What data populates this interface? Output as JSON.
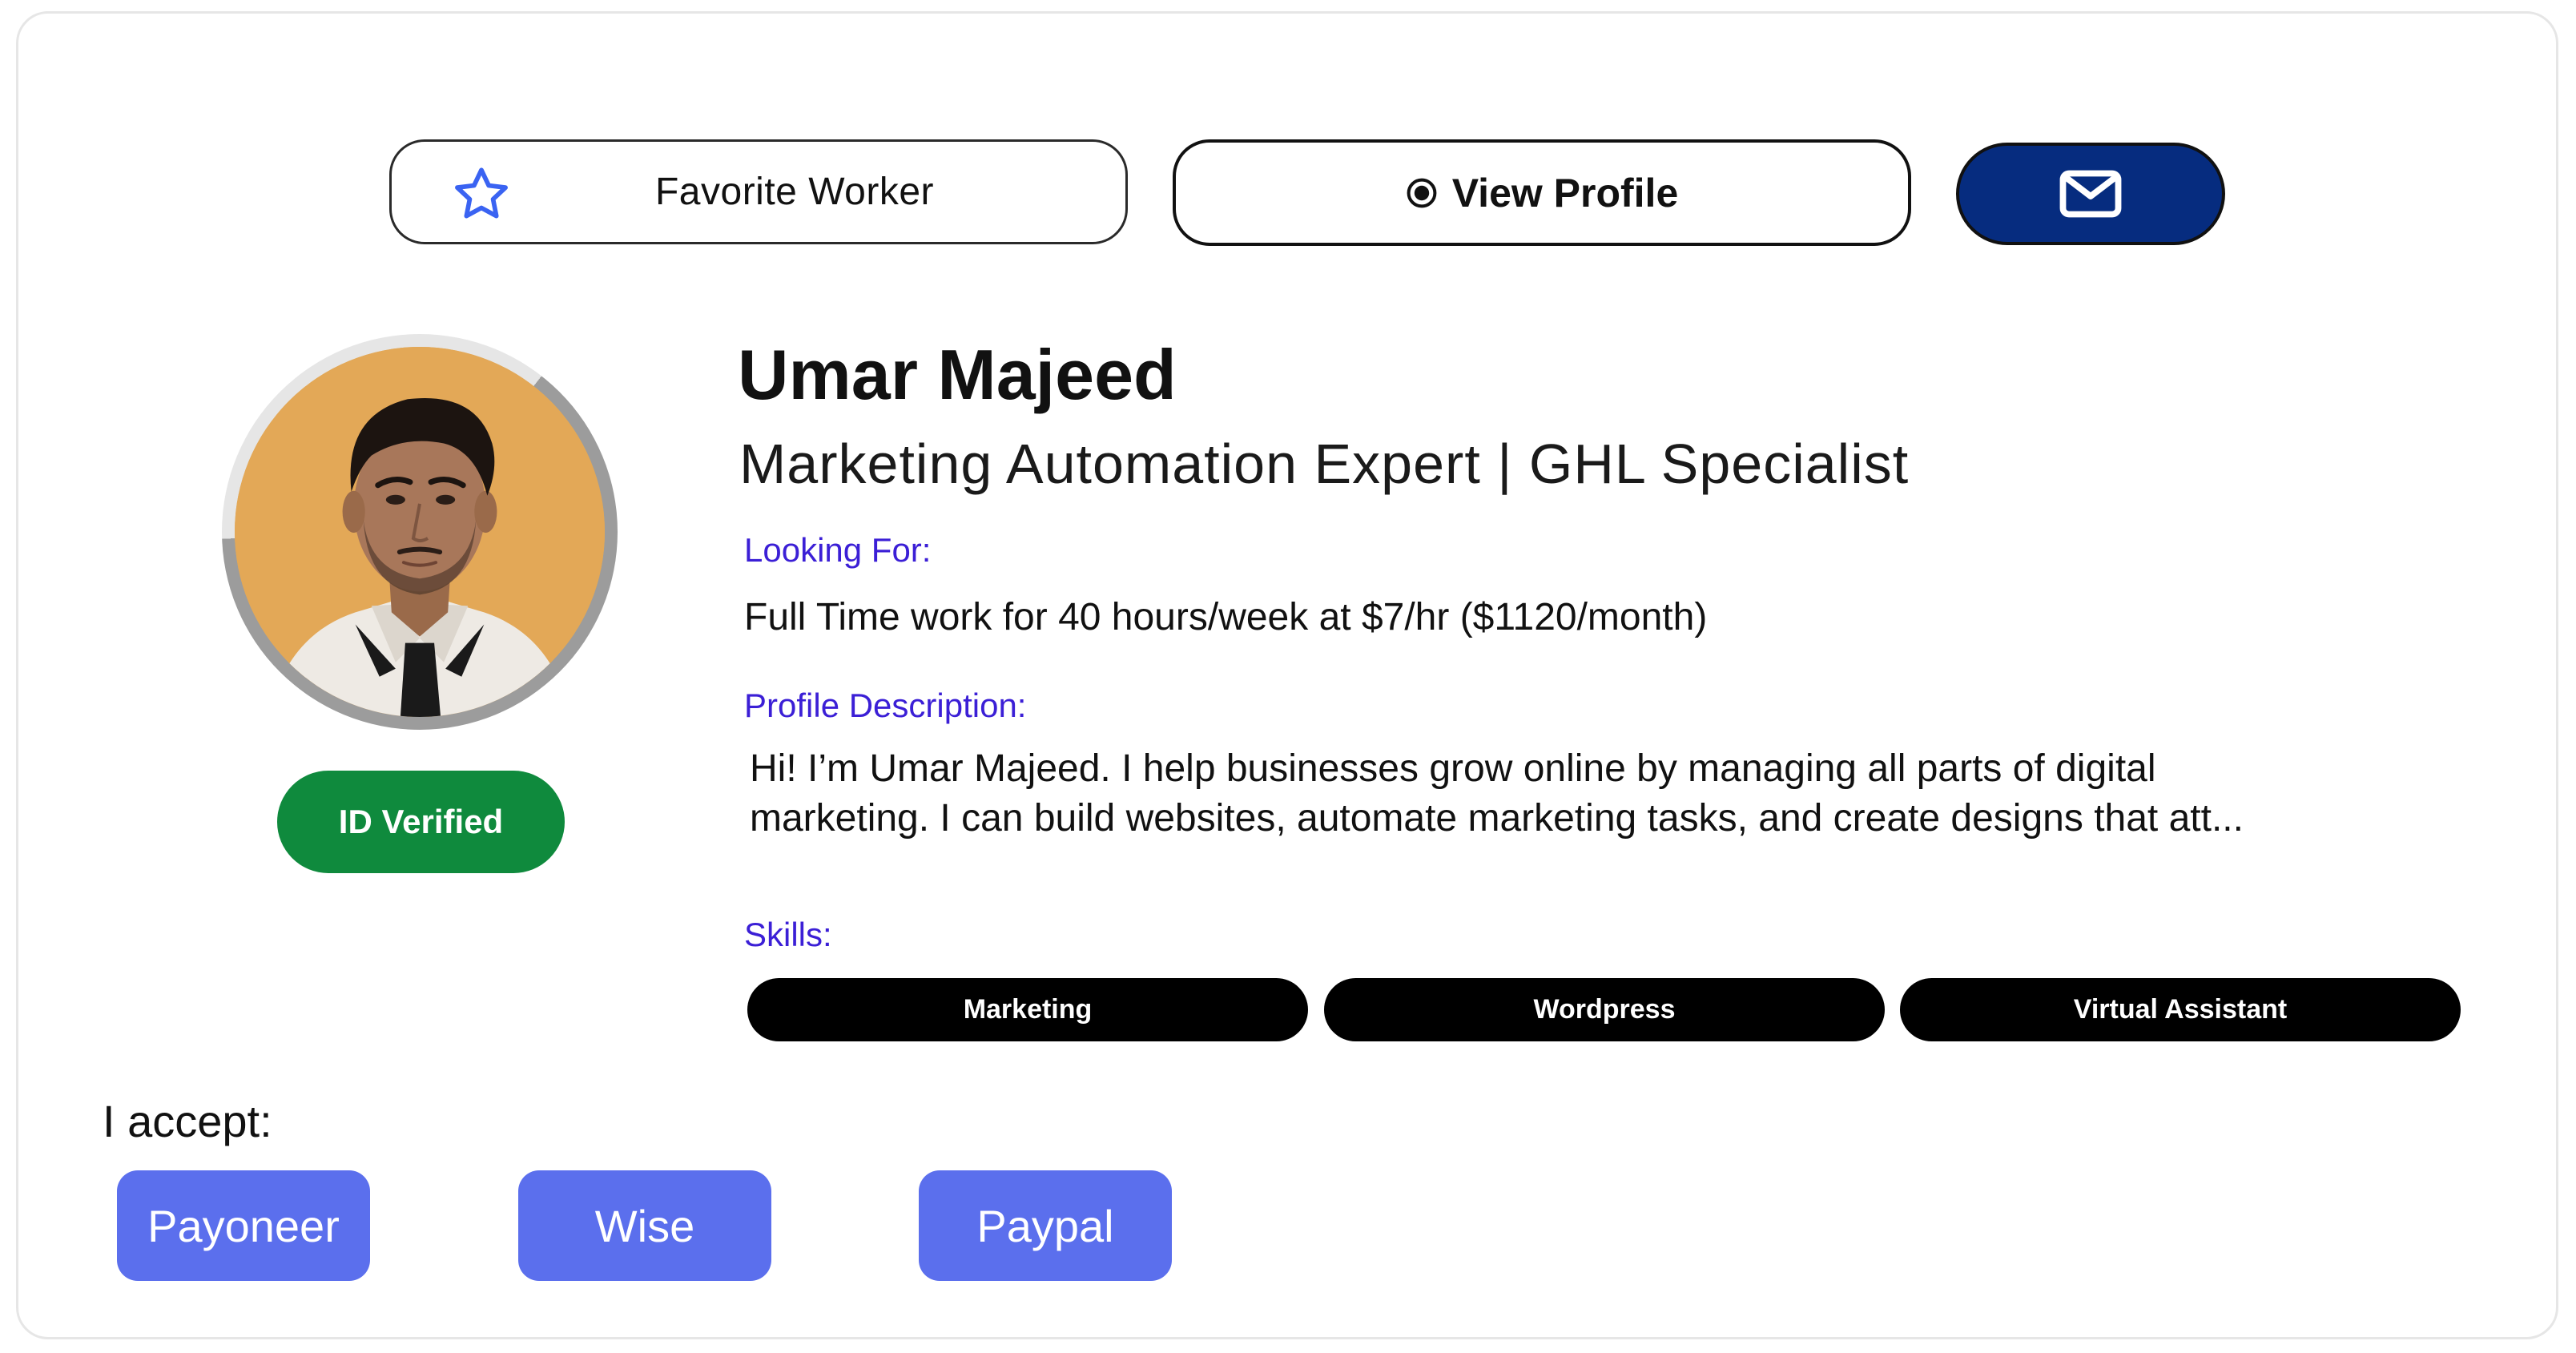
{
  "actions": {
    "favorite_label": "Favorite Worker",
    "view_profile_label": "View Profile",
    "favorite_icon": "star-icon",
    "view_profile_icon": "radio-dot-icon",
    "message_icon": "envelope-icon"
  },
  "profile": {
    "name": "Umar Majeed",
    "headline": "Marketing Automation Expert | GHL Specialist",
    "verified_badge": "ID Verified",
    "looking_for_label": "Looking For:",
    "looking_for_value": "Full Time work for 40 hours/week at $7/hr ($1120/month)",
    "description_label": "Profile Description:",
    "description_value": "Hi! I’m Umar Majeed. I help businesses grow online by managing all parts of digital marketing. I can build websites, automate marketing tasks, and create designs that att...",
    "skills_label": "Skills:",
    "skills": [
      "Marketing",
      "Wordpress",
      "Virtual Assistant"
    ]
  },
  "payments": {
    "label": "I accept:",
    "methods": [
      "Payoneer",
      "Wise",
      "Paypal"
    ]
  },
  "colors": {
    "primary_navy": "#062c7f",
    "verified_green": "#0f8a3d",
    "section_label_purple": "#3b1fd6",
    "payment_blue": "#5b6fed",
    "skill_black": "#000000",
    "star_blue": "#3a63f2"
  }
}
